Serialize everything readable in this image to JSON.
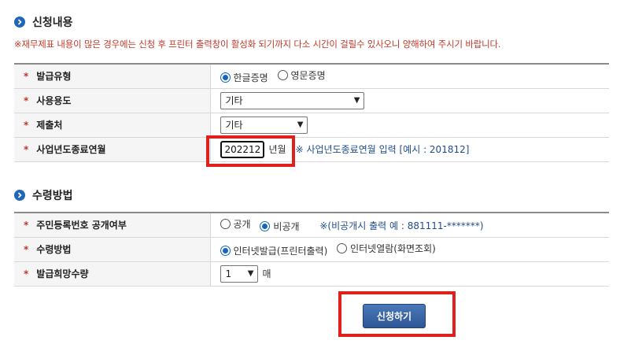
{
  "section1": {
    "title": "신청내용",
    "notice": "※재무제표 내용이 많은 경우에는 신청 후 프린터 출력창이 활성화 되기까지 다소 시간이 걸릴수 있사오니 양해하여 주시기 바랍니다.",
    "rows": {
      "issue_type": {
        "label": "발급유형",
        "options": [
          "한글증명",
          "영문증명"
        ],
        "selected": "한글증명"
      },
      "purpose": {
        "label": "사용용도",
        "value": "기타"
      },
      "submit_to": {
        "label": "제출처",
        "value": "기타"
      },
      "fiscal_end": {
        "label": "사업년도종료연월",
        "value": "202212",
        "unit": "년월",
        "hint": "※ 사업년도종료연월 입력 [예시 : 201812]"
      }
    }
  },
  "section2": {
    "title": "수령방법",
    "rows": {
      "rrn_disclosure": {
        "label": "주민등록번호 공개여부",
        "options": [
          "공개",
          "비공개"
        ],
        "selected": "비공개",
        "hint": "※(비공개시 출력 예 : 881111-*******)"
      },
      "receive_method": {
        "label": "수령방법",
        "options": [
          "인터넷발급(프린터출력)",
          "인터넷열람(화면조회)"
        ],
        "selected": "인터넷발급(프린터출력)"
      },
      "quantity": {
        "label": "발급희망수량",
        "value": "1",
        "unit": "매"
      }
    }
  },
  "submit_label": "신청하기",
  "required_mark": "*",
  "colors": {
    "accent": "#1f67b8",
    "notice": "#c0392b",
    "highlight": "#e0201b",
    "button": "#2d5796"
  }
}
